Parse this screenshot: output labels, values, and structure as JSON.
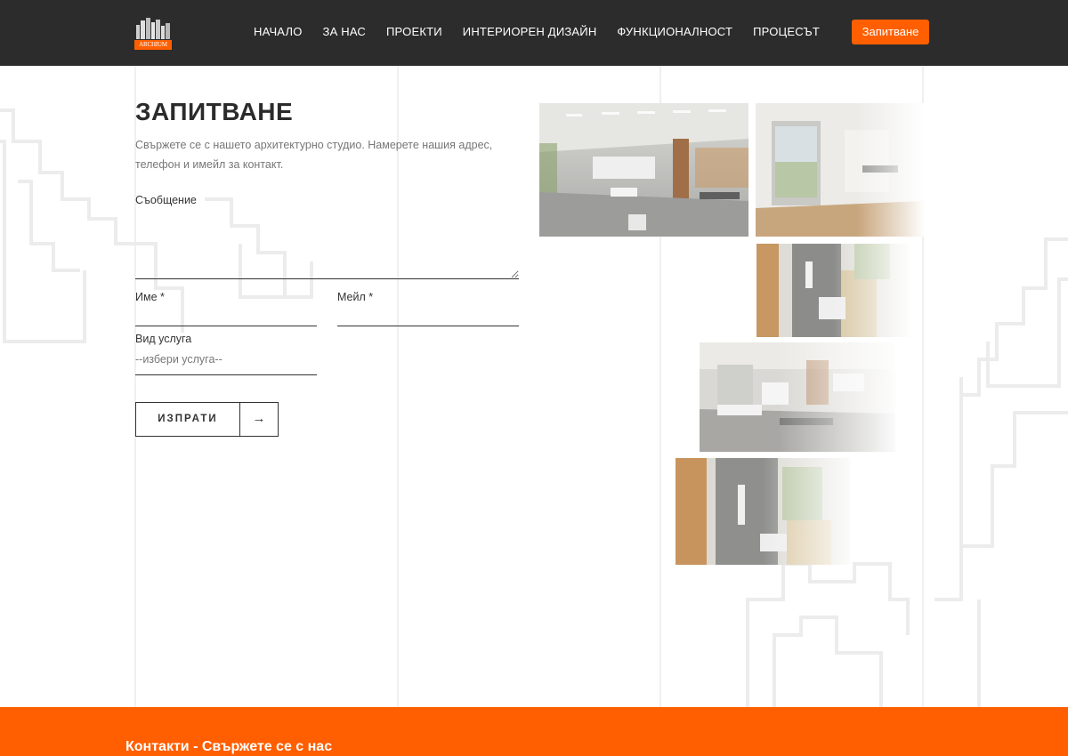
{
  "header": {
    "logo_text": "ARCHIUM",
    "nav": [
      "НАЧАЛО",
      "ЗА НАС",
      "ПРОЕКТИ",
      "ИНТЕРИОРЕН ДИЗАЙН",
      "ФУНКЦИОНАЛНОСТ",
      "ПРОЦЕСЪТ"
    ],
    "cta_label": "Запитване"
  },
  "form": {
    "title": "ЗАПИТВАНЕ",
    "intro": "Свържете се с нашето архитектурно студио. Намерете нашия адрес, телефон и имейл за контакт.",
    "message_label": "Съобщение",
    "message_value": "",
    "name_label": "Име *",
    "name_value": "",
    "email_label": "Мейл *",
    "email_value": "",
    "service_label": "Вид услуга",
    "service_selected": "--избери услуга--",
    "submit_label": "ИЗПРАТИ",
    "submit_arrow": "→"
  },
  "gallery": {
    "images": [
      "office-interior-1",
      "room-window",
      "bathroom-1",
      "office-interior-2",
      "bathroom-2"
    ]
  },
  "footer": {
    "title": "Контакти - Свържете се с нас"
  },
  "colors": {
    "accent": "#ff5f00",
    "header_bg": "#2c2c2c",
    "text": "#333333",
    "muted": "#777777"
  }
}
